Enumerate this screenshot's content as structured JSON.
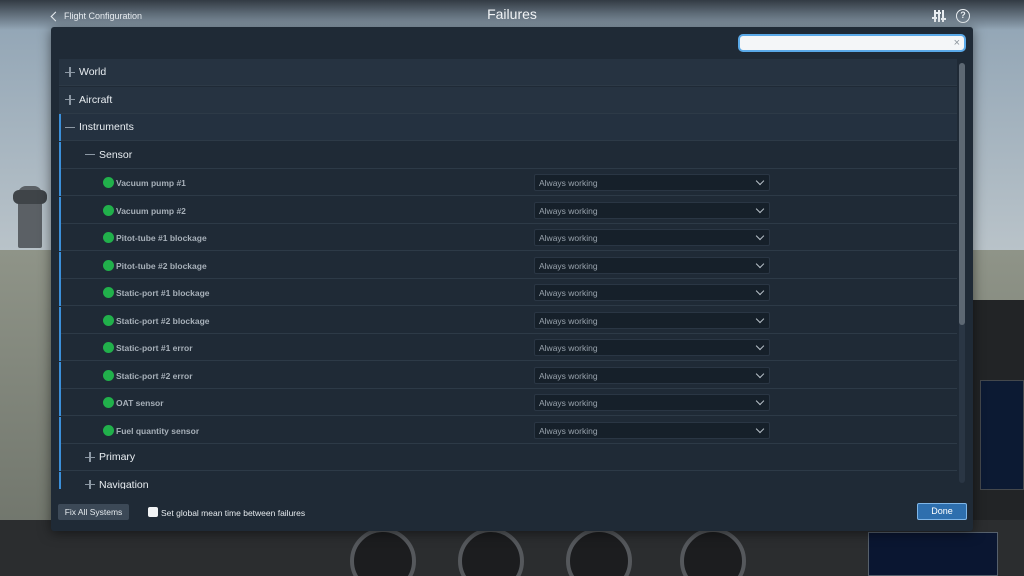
{
  "header": {
    "back_label": "Flight Configuration",
    "title": "Failures"
  },
  "search": {
    "value": "",
    "placeholder": "",
    "clear_glyph": "×"
  },
  "tree": {
    "categories": [
      {
        "label": "World",
        "state": "collapsed"
      },
      {
        "label": "Aircraft",
        "state": "collapsed"
      },
      {
        "label": "Instruments",
        "state": "expanded"
      }
    ],
    "subcategories": [
      {
        "label": "Sensor",
        "state": "expanded"
      },
      {
        "label": "Primary",
        "state": "collapsed"
      },
      {
        "label": "Navigation",
        "state": "collapsed"
      }
    ],
    "items": [
      {
        "label": "Vacuum pump #1",
        "status": "Always working"
      },
      {
        "label": "Vacuum pump #2",
        "status": "Always working"
      },
      {
        "label": "Pitot-tube #1 blockage",
        "status": "Always working"
      },
      {
        "label": "Pitot-tube #2 blockage",
        "status": "Always working"
      },
      {
        "label": "Static-port #1 blockage",
        "status": "Always working"
      },
      {
        "label": "Static-port #2 blockage",
        "status": "Always working"
      },
      {
        "label": "Static-port #1 error",
        "status": "Always working"
      },
      {
        "label": "Static-port #2 error",
        "status": "Always working"
      },
      {
        "label": "OAT sensor",
        "status": "Always working"
      },
      {
        "label": "Fuel quantity sensor",
        "status": "Always working"
      }
    ]
  },
  "footer": {
    "fix_all_label": "Fix All Systems",
    "mtbf_label": "Set global mean time between failures",
    "mtbf_checked": false,
    "done_label": "Done"
  },
  "colors": {
    "status_ok": "#21b04b",
    "accent": "#3b8fd9",
    "dialog_bg": "#1f2a36"
  },
  "icons": {
    "back": "chevron-left-icon",
    "settings": "sliders-icon",
    "help": "help-circle-icon",
    "expand": "plus-icon",
    "collapse": "minus-icon",
    "status": "green-dot-icon"
  }
}
